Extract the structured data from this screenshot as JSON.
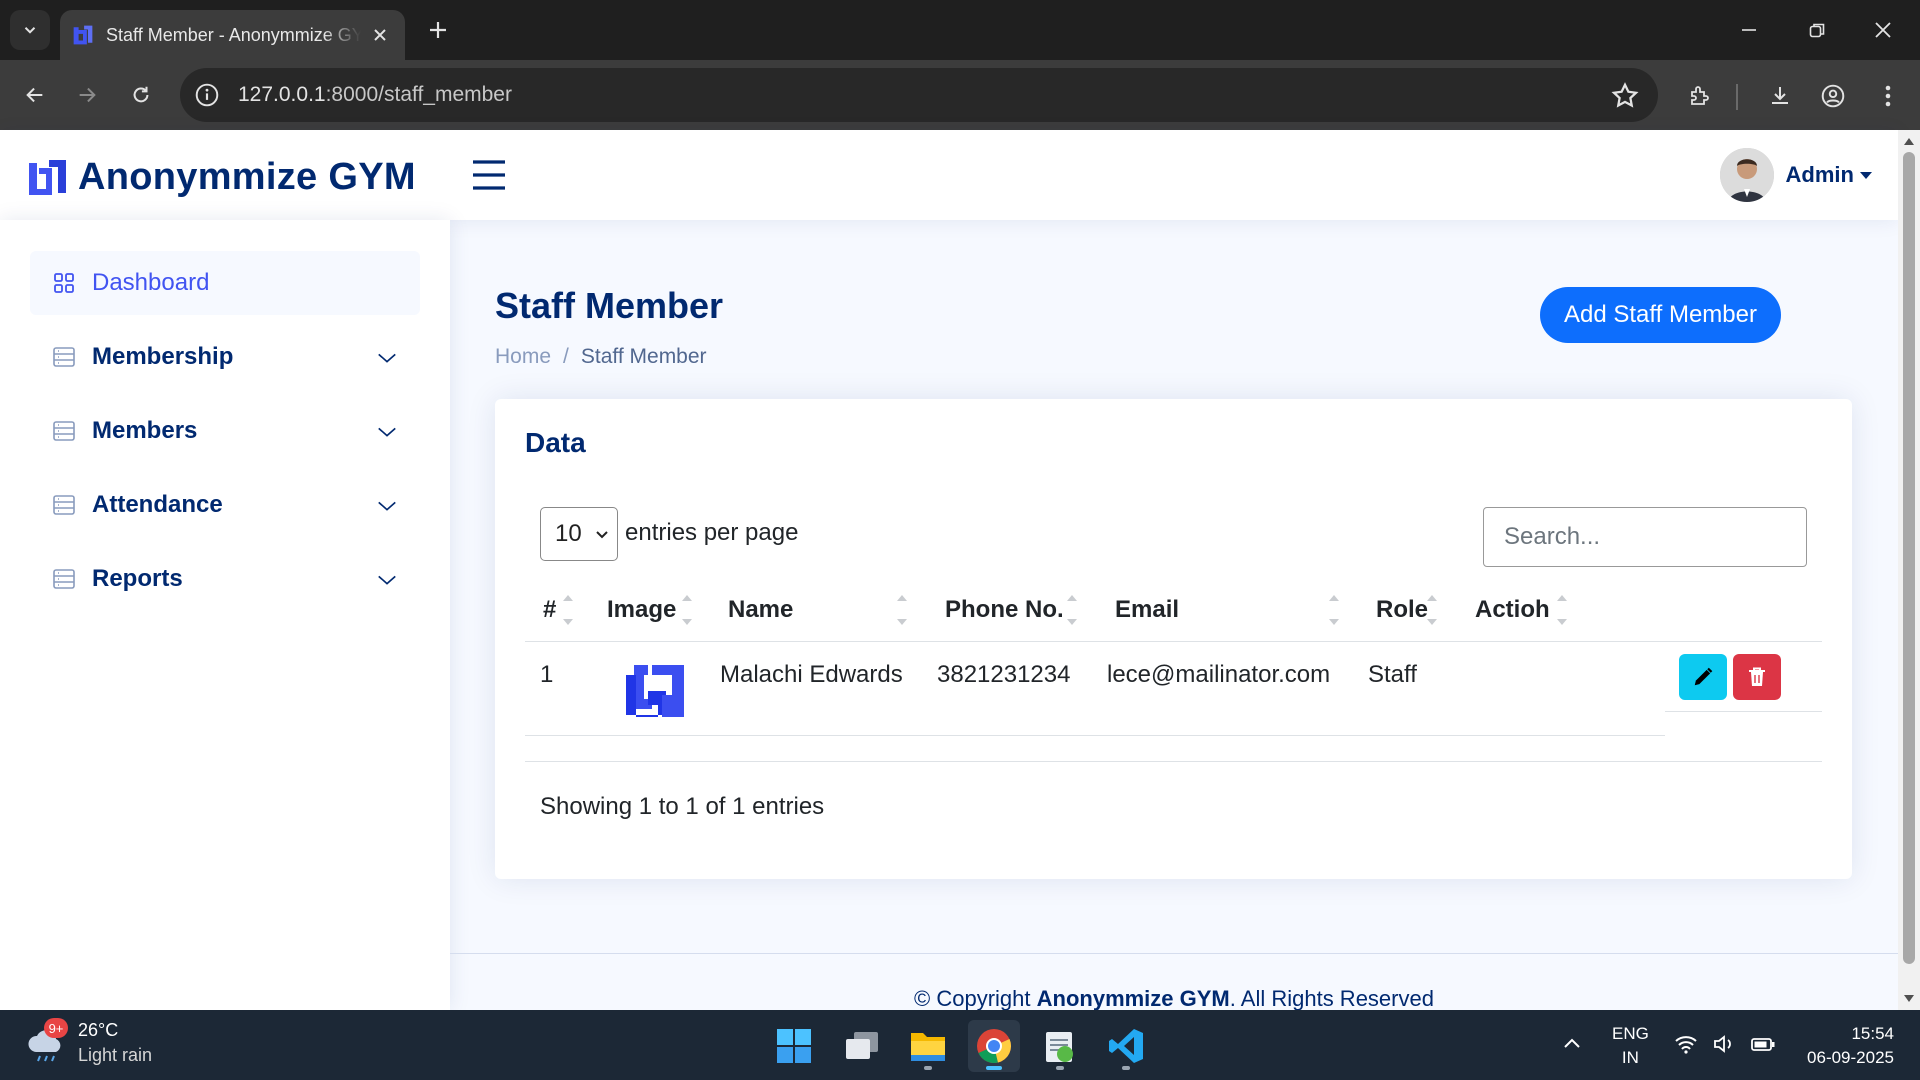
{
  "browser": {
    "tab_title": "Staff Member - Anonymmize GYM",
    "new_tab_icon": "plus-icon",
    "url_host": "127.0.0.1",
    "url_path": ":8000/staff_member",
    "colors": {
      "chrome_dark": "#1f1f1f",
      "toolbar": "#3c3c3c"
    }
  },
  "header": {
    "brand": "Anonymmize GYM",
    "user_name": "Admin",
    "brand_color": "#012970",
    "accent": "#4154f1"
  },
  "sidebar": {
    "items": [
      {
        "label": "Dashboard",
        "icon": "grid-icon",
        "active": true
      },
      {
        "label": "Membership",
        "icon": "list-icon",
        "expandable": true
      },
      {
        "label": "Members",
        "icon": "list-icon",
        "expandable": true
      },
      {
        "label": "Attendance",
        "icon": "list-icon",
        "expandable": true
      },
      {
        "label": "Reports",
        "icon": "list-icon",
        "expandable": true
      }
    ]
  },
  "page": {
    "title": "Staff Member",
    "breadcrumb": [
      "Home",
      "/",
      "Staff Member"
    ],
    "add_button": "Add Staff Member"
  },
  "card": {
    "title": "Data",
    "per_page_value": "10",
    "per_page_label": "entries per page",
    "search_placeholder": "Search...",
    "columns": [
      "#",
      "Image",
      "Name",
      "Phone No.",
      "Email",
      "Role",
      "Actioh"
    ],
    "rows": [
      {
        "num": "1",
        "name": "Malachi Edwards",
        "phone": "3821231234",
        "email": "lece@mailinator.com",
        "role": "Staff"
      }
    ],
    "info": "Showing 1 to 1 of 1 entries"
  },
  "footer": {
    "prefix": "© Copyright ",
    "brand": "Anonymmize GYM",
    "suffix": ". All Rights Reserved"
  },
  "taskbar": {
    "weather_temp": "26°C",
    "weather_desc": "Light rain",
    "weather_badge": "9+",
    "lang_1": "ENG",
    "lang_2": "IN",
    "time": "15:54",
    "date": "06-09-2025"
  }
}
